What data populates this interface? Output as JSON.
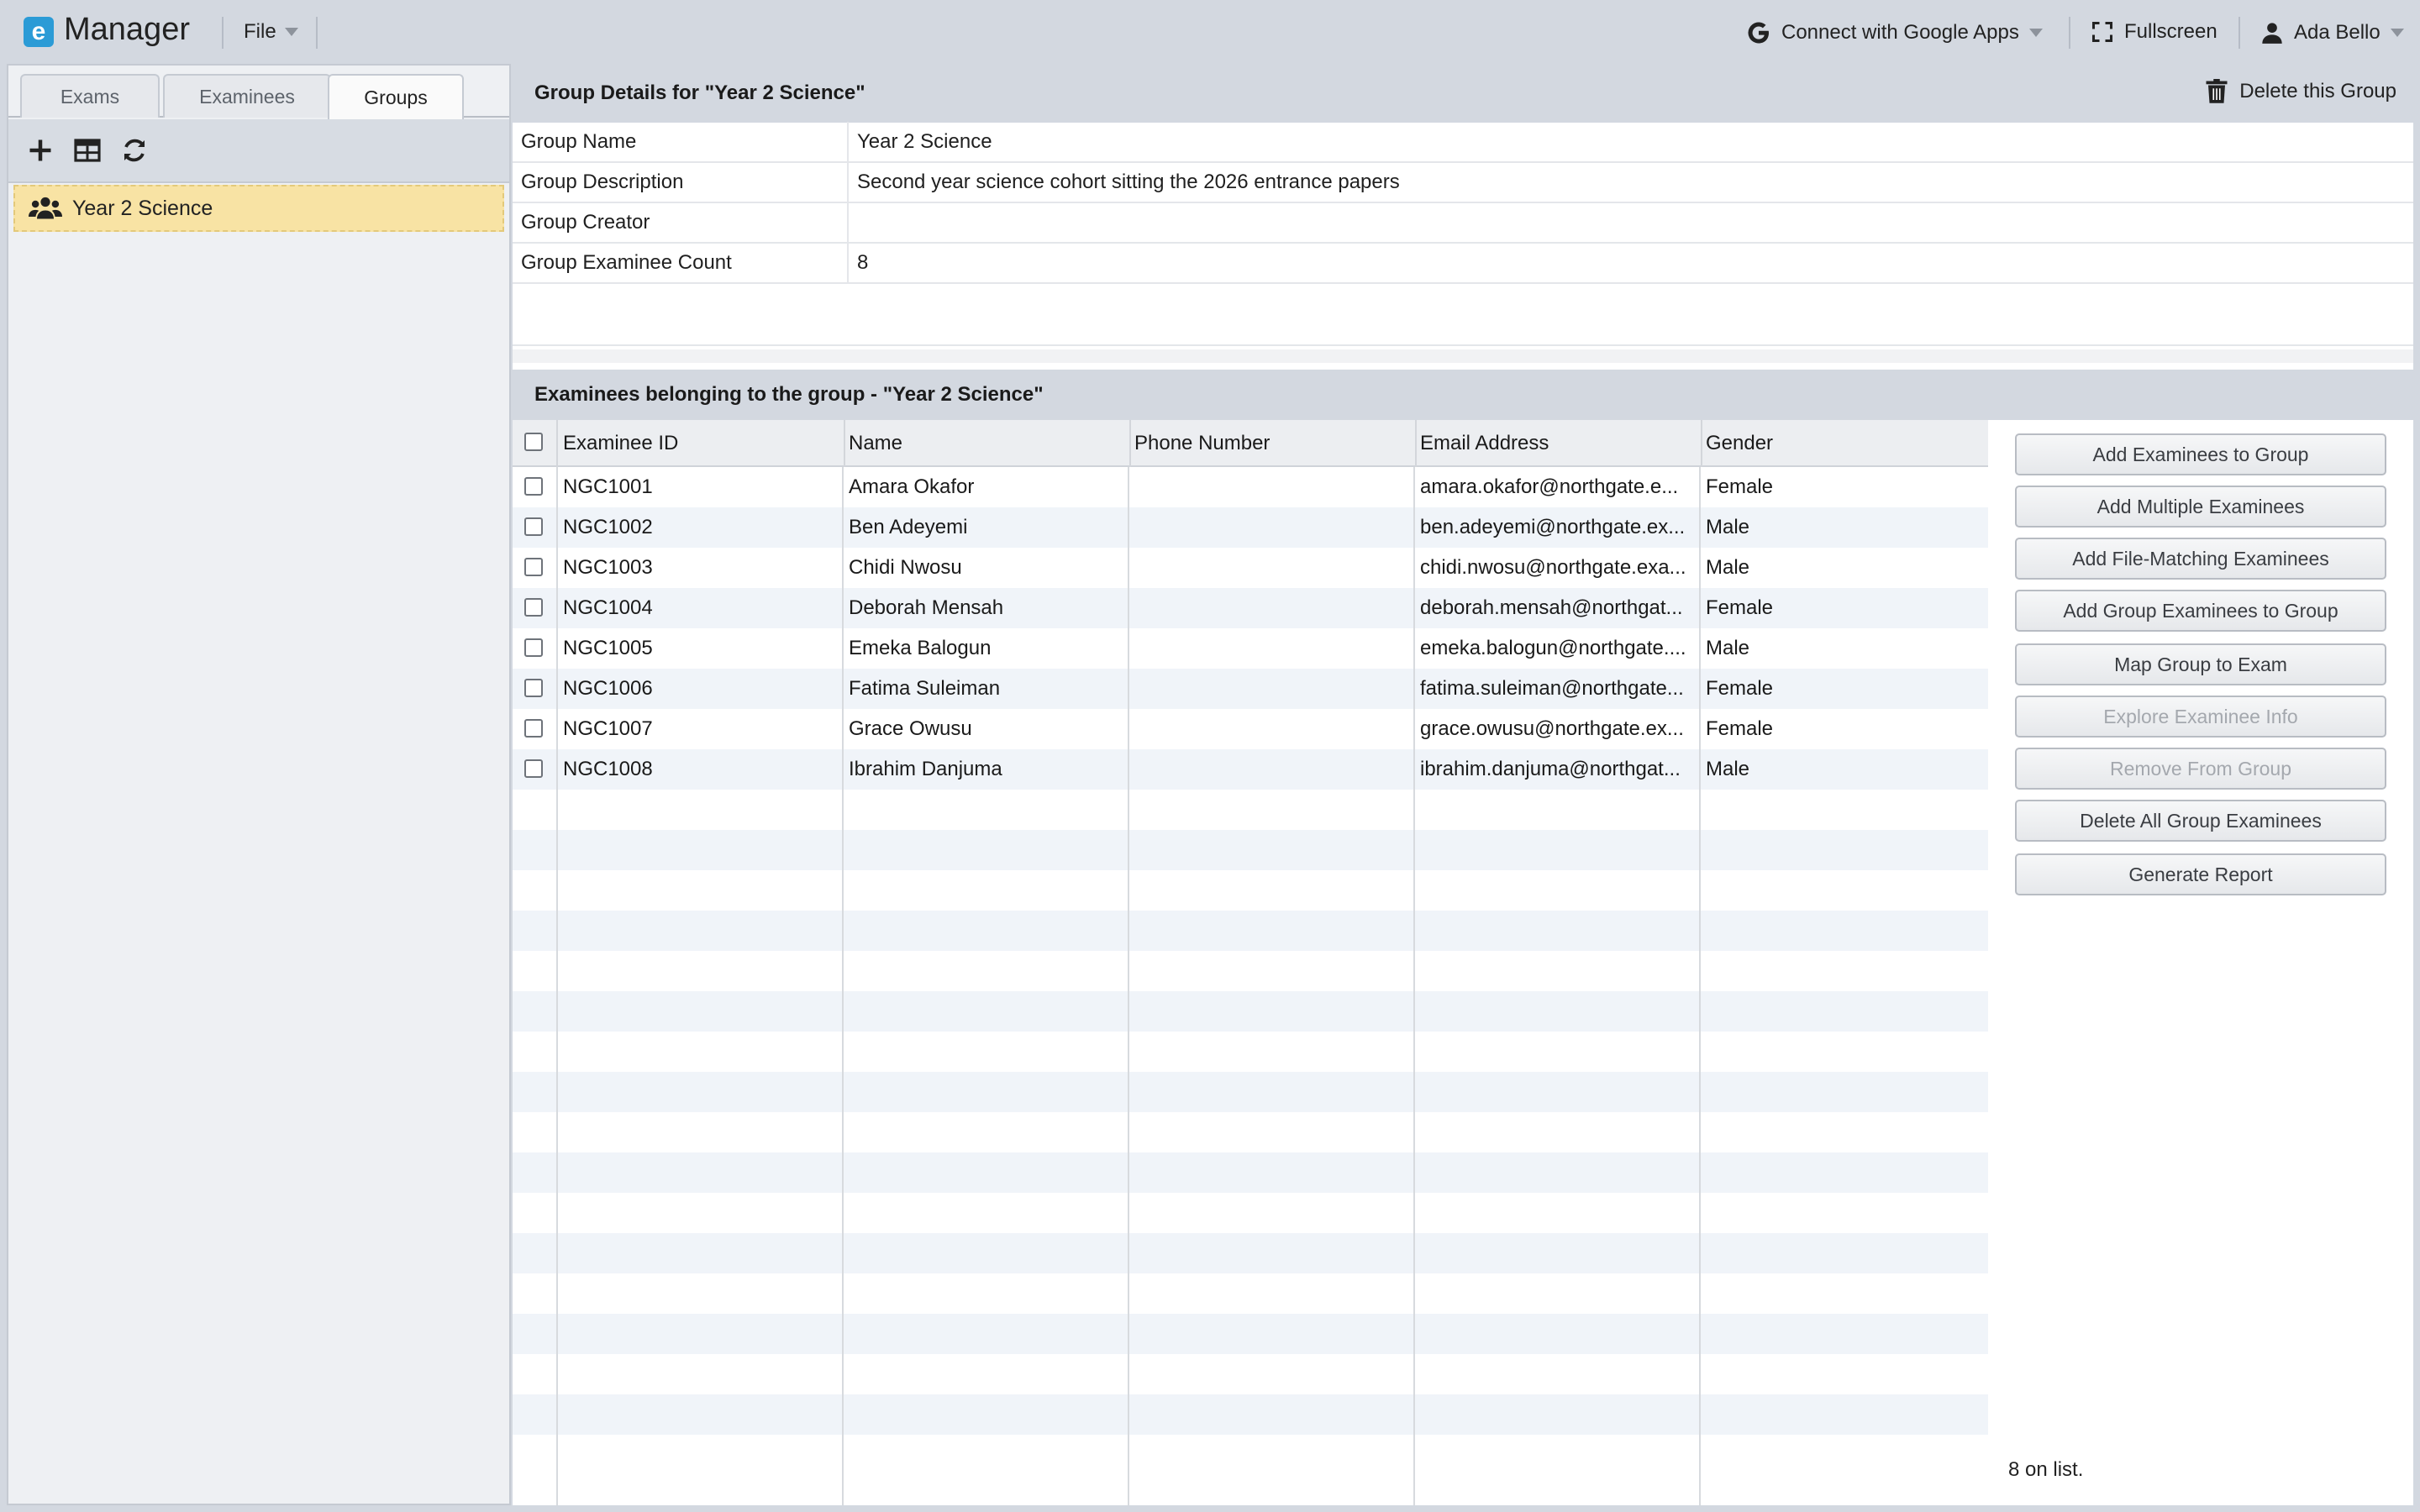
{
  "app": {
    "logo_letter": "e",
    "title": "Manager"
  },
  "menu": {
    "file": "File"
  },
  "top_right": {
    "google": "Connect with Google Apps",
    "fullscreen": "Fullscreen",
    "user": "Ada Bello"
  },
  "left": {
    "tabs": [
      "Exams",
      "Examinees",
      "Groups"
    ],
    "active_tab": "Groups",
    "groups": [
      "Year 2 Science"
    ]
  },
  "details": {
    "header": "Group Details for \"Year 2 Science\"",
    "delete_label": "Delete this Group",
    "rows": [
      {
        "label": "Group Name",
        "value": "Year 2 Science"
      },
      {
        "label": "Group Description",
        "value": "Second year science cohort sitting the 2026 entrance papers"
      },
      {
        "label": "Group Creator",
        "value": ""
      },
      {
        "label": "Group Examinee Count",
        "value": "8"
      }
    ]
  },
  "examinees": {
    "header": "Examinees belonging to the group - \"Year 2 Science\"",
    "columns": [
      "Examinee ID",
      "Name",
      "Phone Number",
      "Email Address",
      "Gender"
    ],
    "rows": [
      {
        "id": "NGC1001",
        "name": "Amara Okafor",
        "phone": "",
        "email": "amara.okafor@northgate.e...",
        "gender": "Female"
      },
      {
        "id": "NGC1002",
        "name": "Ben Adeyemi",
        "phone": "",
        "email": "ben.adeyemi@northgate.ex...",
        "gender": "Male"
      },
      {
        "id": "NGC1003",
        "name": "Chidi Nwosu",
        "phone": "",
        "email": "chidi.nwosu@northgate.exa...",
        "gender": "Male"
      },
      {
        "id": "NGC1004",
        "name": "Deborah Mensah",
        "phone": "",
        "email": "deborah.mensah@northgat...",
        "gender": "Female"
      },
      {
        "id": "NGC1005",
        "name": "Emeka Balogun",
        "phone": "",
        "email": "emeka.balogun@northgate....",
        "gender": "Male"
      },
      {
        "id": "NGC1006",
        "name": "Fatima Suleiman",
        "phone": "",
        "email": "fatima.suleiman@northgate...",
        "gender": "Female"
      },
      {
        "id": "NGC1007",
        "name": "Grace Owusu",
        "phone": "",
        "email": "grace.owusu@northgate.ex...",
        "gender": "Female"
      },
      {
        "id": "NGC1008",
        "name": "Ibrahim Danjuma",
        "phone": "",
        "email": "ibrahim.danjuma@northgat...",
        "gender": "Male"
      }
    ],
    "count_label": "8 on list."
  },
  "actions": [
    {
      "label": "Add Examinees to Group",
      "enabled": true
    },
    {
      "label": "Add Multiple Examinees",
      "enabled": true
    },
    {
      "label": "Add File-Matching Examinees",
      "enabled": true
    },
    {
      "label": "Add Group Examinees to Group",
      "enabled": true
    },
    {
      "label": "Map Group to Exam",
      "enabled": true
    },
    {
      "label": "Explore Examinee Info",
      "enabled": false
    },
    {
      "label": "Remove From Group",
      "enabled": false
    },
    {
      "label": "Delete All Group Examinees",
      "enabled": true
    },
    {
      "label": "Generate Report",
      "enabled": true
    }
  ],
  "colors": {
    "accent": "#2b9bd6",
    "selected_group": "#f8e3a4",
    "header_bg": "#d3d8e0"
  },
  "icons": {
    "logo": "app-logo-icon",
    "google": "google-g-icon",
    "fullscreen": "fullscreen-icon",
    "user": "user-icon",
    "add": "plus-icon",
    "table": "table-icon",
    "refresh": "refresh-icon",
    "group": "users-icon",
    "trash": "trash-icon"
  }
}
